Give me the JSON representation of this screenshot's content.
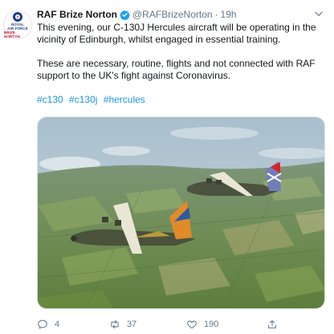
{
  "tweet": {
    "author_name": "RAF Brize Norton",
    "handle": "@RAFBrizeNorton",
    "separator": "·",
    "time": "19h",
    "avatar_lines": [
      "ROYAL",
      "AIR FORCE",
      "BRIZE NORTON"
    ],
    "paragraph_1": "This evening, our C-130J Hercules aircraft will be operating in the vicinity of Edinburgh, whilst engaged in essential training.",
    "paragraph_2": "These are necessary, routine, flights and not connected with RAF support to the UK's fight against Coronavirus.",
    "hashtags": [
      "#c130",
      "#c130j",
      "#hercules"
    ],
    "verified_icon": "verified-badge-icon",
    "media_icon": "photo-two-c130-hercules"
  },
  "actions": {
    "reply_count": "4",
    "retweet_count": "37",
    "like_count": "190"
  },
  "colors": {
    "link": "#1b95e0",
    "muted": "#657786",
    "verified": "#1da1f2"
  }
}
